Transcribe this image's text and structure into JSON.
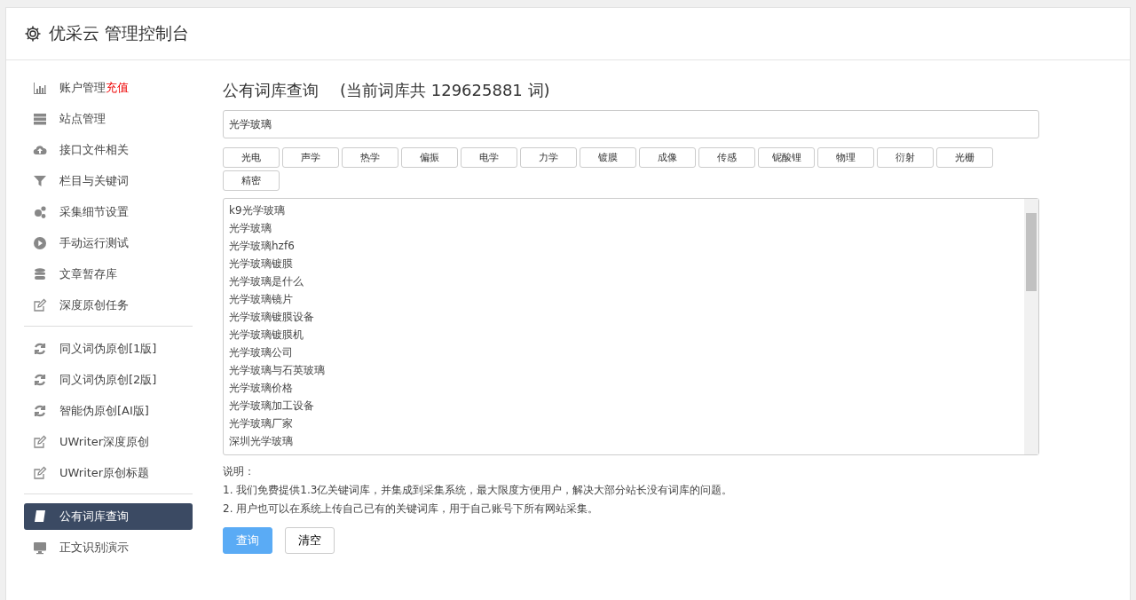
{
  "header": {
    "title": "优采云 管理控制台"
  },
  "sidebar": {
    "groups": [
      {
        "items": [
          {
            "label": "账户管理",
            "badge": "充值",
            "selected": false
          },
          {
            "label": "站点管理",
            "selected": false
          },
          {
            "label": "接口文件相关",
            "selected": false
          },
          {
            "label": "栏目与关键词",
            "selected": false
          },
          {
            "label": "采集细节设置",
            "selected": false
          },
          {
            "label": "手动运行测试",
            "selected": false
          },
          {
            "label": "文章暂存库",
            "selected": false
          },
          {
            "label": "深度原创任务",
            "selected": false
          }
        ]
      },
      {
        "items": [
          {
            "label": "同义词伪原创[1版]",
            "selected": false
          },
          {
            "label": "同义词伪原创[2版]",
            "selected": false
          },
          {
            "label": "智能伪原创[AI版]",
            "selected": false
          },
          {
            "label": "UWriter深度原创",
            "selected": false
          },
          {
            "label": "UWriter原创标题",
            "selected": false
          }
        ]
      },
      {
        "items": [
          {
            "label": "公有词库查询",
            "selected": true
          },
          {
            "label": "正文识别演示",
            "selected": false
          }
        ]
      }
    ]
  },
  "main": {
    "title": "公有词库查询",
    "subtitle": "(当前词库共 129625881 词)",
    "search": {
      "value": "光学玻璃"
    },
    "tags": [
      "光电",
      "声学",
      "热学",
      "偏振",
      "电学",
      "力学",
      "镀膜",
      "成像",
      "传感",
      "铌酸锂",
      "物理",
      "衍射",
      "光栅",
      "精密"
    ],
    "results": [
      "k9光学玻璃",
      "光学玻璃",
      "光学玻璃hzf6",
      "光学玻璃镀膜",
      "光学玻璃是什么",
      "光学玻璃镜片",
      "光学玻璃镀膜设备",
      "光学玻璃镀膜机",
      "光学玻璃公司",
      "光学玻璃与石英玻璃",
      "光学玻璃价格",
      "光学玻璃加工设备",
      "光学玻璃厂家",
      "深圳光学玻璃"
    ],
    "notes_title": "说明：",
    "notes": [
      "1. 我们免费提供1.3亿关键词库，并集成到采集系统，最大限度方便用户，解决大部分站长没有词库的问题。",
      "2. 用户也可以在系统上传自己已有的关键词库，用于自己账号下所有网站采集。"
    ],
    "buttons": [
      {
        "label": "查询",
        "kind": "primary"
      },
      {
        "label": "清空",
        "kind": "default"
      }
    ]
  }
}
